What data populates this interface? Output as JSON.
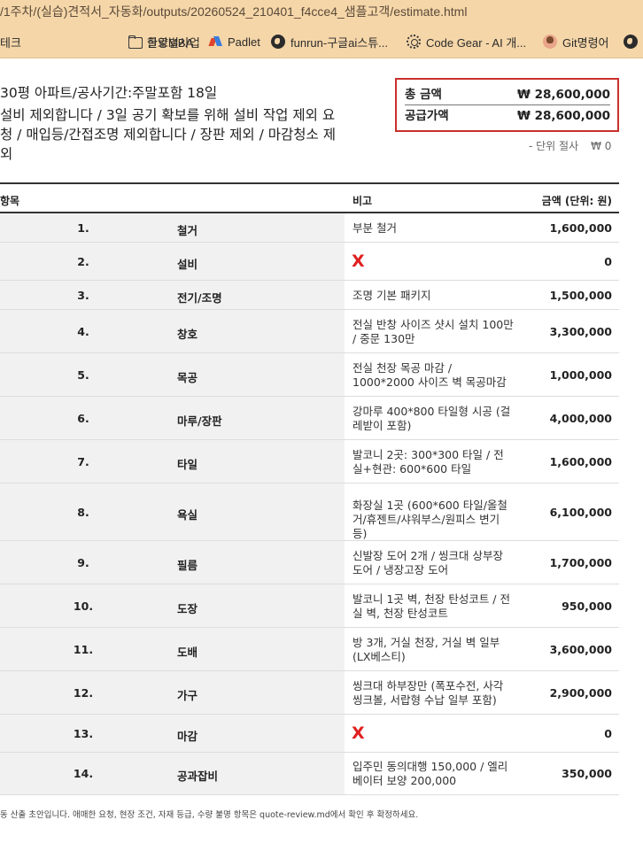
{
  "browser": {
    "url": "/1주차/(실습)견적서_자동화/outputs/20260524_210401_f4cce4_샘플고객/estimate.html",
    "bookmarks": [
      {
        "label": "테크",
        "icon": "folder-icon"
      },
      {
        "label": "글로벌사업",
        "icon": "folder-icon"
      },
      {
        "label": "한양MBA",
        "icon": "folder-icon"
      },
      {
        "label": "Padlet",
        "icon": "padlet-icon"
      },
      {
        "label": "funrun-구글ai스튜...",
        "icon": "globe-icon"
      },
      {
        "label": "Code Gear - AI 개...",
        "icon": "gear-icon"
      },
      {
        "label": "Git명령어",
        "icon": "avatar-icon"
      },
      {
        "label": "",
        "icon": "globe-icon"
      }
    ]
  },
  "estimate": {
    "project_title": "30평 아파트/공사기간:주말포함 18일",
    "notes": [
      "설비 제외합니다 / 3일 공기 확보를 위해 설비 작업 제외 요",
      "청 / 매입등/간접조명 제외합니다 / 장판 제외 / 마감청소 제",
      "외"
    ],
    "totals": {
      "total_label": "총 금액",
      "total_value": "₩ 28,600,000",
      "supply_label": "공급가액",
      "supply_value": "₩ 28,600,000"
    },
    "unit_note": {
      "label": "- 단위 절사",
      "value": "₩ 0"
    },
    "table": {
      "headers": {
        "item": "항목",
        "note": "비고",
        "amount": "금액 (단위: 원)"
      },
      "rows": [
        {
          "num": "1.",
          "name": "철거",
          "note": "부분 철거",
          "amount": "1,600,000",
          "excluded": false
        },
        {
          "num": "2.",
          "name": "설비",
          "note": "",
          "amount": "0",
          "excluded": true
        },
        {
          "num": "3.",
          "name": "전기/조명",
          "note": "조명 기본 패키지",
          "amount": "1,500,000",
          "excluded": false
        },
        {
          "num": "4.",
          "name": "창호",
          "note": "전실 반창 사이즈 샷시 설치 100만 / 중문 130만",
          "amount": "3,300,000",
          "excluded": false
        },
        {
          "num": "5.",
          "name": "목공",
          "note": "전실 천장 목공 마감 / 1000*2000 사이즈 벽 목공마감",
          "amount": "1,000,000",
          "excluded": false
        },
        {
          "num": "6.",
          "name": "마루/장판",
          "note": "강마루 400*800 타일형 시공 (걸레받이 포함)",
          "amount": "4,000,000",
          "excluded": false
        },
        {
          "num": "7.",
          "name": "타일",
          "note": "발코니 2곳: 300*300 타일 / 전실+현관: 600*600 타일",
          "amount": "1,600,000",
          "excluded": false
        },
        {
          "num": "8.",
          "name": "욕실",
          "note": "화장실 1곳 (600*600 타일/올철거/휴젠트/샤워부스/원피스 변기등)",
          "amount": "6,100,000",
          "excluded": false
        },
        {
          "num": "9.",
          "name": "필름",
          "note": "신발장 도어 2개 / 씽크대 상부장 도어 / 냉장고장 도어",
          "amount": "1,700,000",
          "excluded": false
        },
        {
          "num": "10.",
          "name": "도장",
          "note": "발코니 1곳 벽, 천장 탄성코트 / 전실 벽, 천장 탄성코트",
          "amount": "950,000",
          "excluded": false
        },
        {
          "num": "11.",
          "name": "도배",
          "note": "방 3개, 거실 천장, 거실 벽 일부 (LX베스티)",
          "amount": "3,600,000",
          "excluded": false
        },
        {
          "num": "12.",
          "name": "가구",
          "note": "씽크대 하부장만 (폭포수전, 사각 씽크볼, 서랍형 수납 일부 포함)",
          "amount": "2,900,000",
          "excluded": false
        },
        {
          "num": "13.",
          "name": "마감",
          "note": "",
          "amount": "0",
          "excluded": true
        },
        {
          "num": "14.",
          "name": "공과잡비",
          "note": "입주민 동의대행 150,000 / 엘리베이터 보양 200,000",
          "amount": "350,000",
          "excluded": false
        }
      ]
    },
    "excluded_mark": "X",
    "footnote": "동 산출 초안입니다. 애매한 요청, 현장 조건, 자재 등급, 수량 불명 항목은 quote-review.md에서 확인 후 확정하세요."
  }
}
